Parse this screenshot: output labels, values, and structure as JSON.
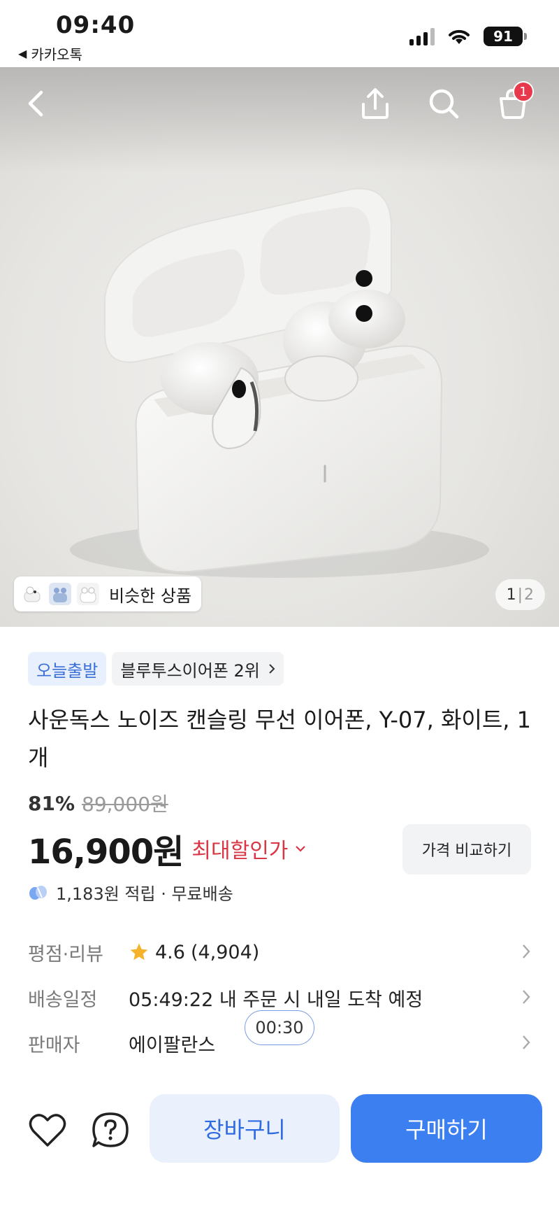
{
  "status_bar": {
    "time": "09:40",
    "back_app": "카카오톡",
    "battery": "91"
  },
  "hero": {
    "cart_badge": "1",
    "similar_label": "비슷한 상품",
    "pager_current": "1",
    "pager_sep": "|",
    "pager_total": "2"
  },
  "product": {
    "tag_today": "오늘출발",
    "tag_rank": "블루투스이어폰 2위",
    "title": "사운독스 노이즈 캔슬링 무선 이어폰, Y-07, 화이트, 1개",
    "discount_rate": "81%",
    "original_price": "89,000원",
    "price": "16,900원",
    "max_discount_label": "최대할인가",
    "compare_button": "가격 비교하기",
    "reward": "1,183원 적립 · 무료배송"
  },
  "meta": {
    "rating_label": "평점·리뷰",
    "rating_value": "4.6",
    "review_count": "(4,904)",
    "delivery_label": "배송일정",
    "delivery_value": "05:49:22 내 주문 시 내일 도착 예정",
    "seller_label": "판매자",
    "seller_value": "에이팔란스",
    "timer": "00:30"
  },
  "bottom": {
    "cart_button": "장바구니",
    "buy_button": "구매하기"
  },
  "colors": {
    "accent": "#3b7ff0",
    "discount_red": "#d93645",
    "badge_red": "#e8394c",
    "star": "#f5b32b"
  }
}
